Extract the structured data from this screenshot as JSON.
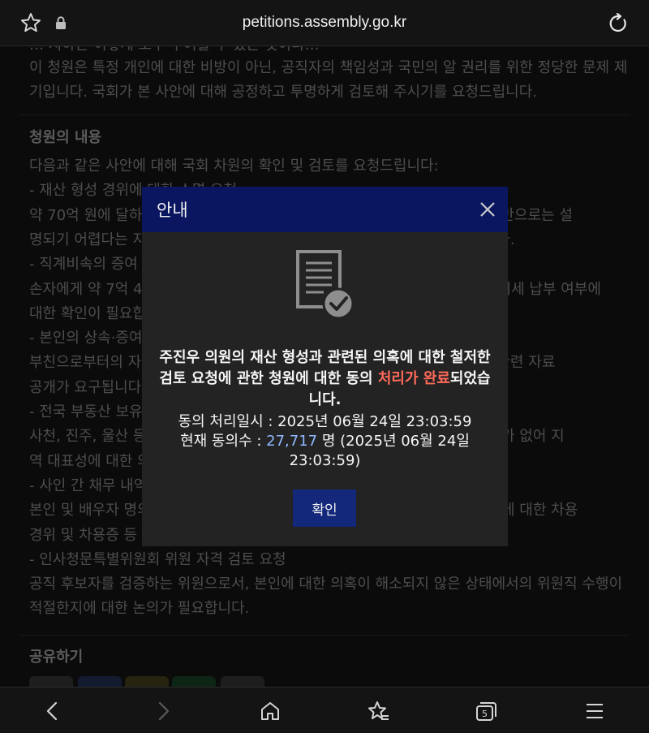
{
  "browser": {
    "url": "petitions.assembly.go.kr",
    "tab_count": "5"
  },
  "page": {
    "partial_top_line": "… 지하는 이렇게 모두 부여할 수 있는 것이다…",
    "intro_lines": [
      "이 청원은 특정 개인에 대한 비방이 아닌, 공직자의 책임성과 국민의 알 권리를 위한 정당한 문제 제",
      "기입니다. 국회가 본 사안에 대해 공정하고 투명하게 검토해 주시기를 요청드립니다."
    ],
    "section_title": "청원의 내용",
    "body_lines": [
      "다음과 같은 사안에 대해 국회 차원의 확인 및 검토를 요청드립니다:",
      "- 재산 형성 경위에 대한 소명 요청",
      "약 70억 원에 달하는 재산이 공직 재임 기간의 급여 및 가족 소득(약 10년 반)만으로는 설",
      "명되기 어렵다는 지적이 있어, 재산 형성 과정에 대한 명확한 소명이 필요합니다.",
      "- 직계비속의 증여 및 세금 납부 여부",
      "손자에게 약 7억 4천만 원 상당의 재산이 증여된 것으로 알려져, 이에 대한 증여세 납부 여부에",
      "대한 확인이 필요합니다.",
      "- 본인의 상속·증여 관련 자료 공개",
      "부친으로부터의 자산 상속 또는 증여 여부가 불분명하여, 투명한 검증을 위해 관련 자료",
      "공개가 요구됩니다.",
      "- 전국 부동산 보유 현황",
      "사천, 진주, 울산 등 전국 각지에 부동산을 보유하고 있으나 지역구에 실거주지가 없어 지",
      "역 대표성에 대한 의문이 제기되고 있습니다.",
      "- 사인 간 채무 내역",
      "본인 및 배우자 명의로 사인 간 채무가 존재한다는 의혹이 제기되고 있으며, 이에 대한 차용",
      "경위 및 차용증 등 관련 자료의 확인이 필요합니다.",
      "- 인사청문특별위원회 위원 자격 검토 요청",
      "공직 후보자를 검증하는 위원으로서, 본인에 대한 의혹이 해소되지 않은 상태에서의 위원직 수행이",
      "적절한지에 대한 논의가 필요합니다."
    ],
    "share_title": "공유하기"
  },
  "modal": {
    "title": "안내",
    "message_before": "주진우 의원의 재산 형성과 관련된 의혹에 대한 철저한 검토 요청에 관한 청원에 대한 동의 ",
    "message_highlight": "처리가 완료",
    "message_after": "되었습니다.",
    "processed_label": "동의 처리일시 : ",
    "processed_value": "2025년 06월 24일 23:03:59",
    "count_label": "현재 동의수 : ",
    "count_value": "27,717",
    "count_suffix": " 명 (2025년 06월 24일 23:03:59)",
    "confirm_label": "확인"
  },
  "colors": {
    "modal_header": "#0b1660",
    "confirm_button": "#13287a",
    "highlight": "#ff6a5a",
    "count": "#8fb8ff"
  },
  "icons": [
    "star-icon",
    "lock-icon",
    "reload-icon",
    "close-icon",
    "document-check-icon",
    "back-icon",
    "forward-icon",
    "home-icon",
    "bookmarks-icon",
    "tabs-icon",
    "menu-icon"
  ]
}
